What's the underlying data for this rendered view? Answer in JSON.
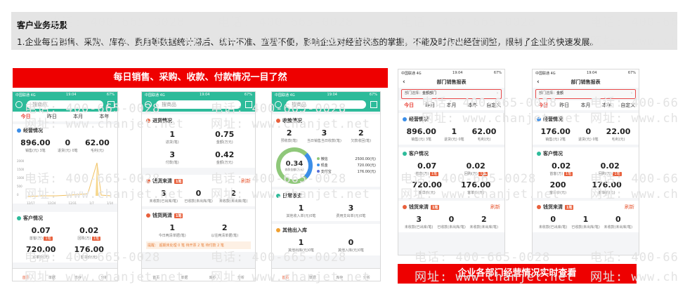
{
  "header": {
    "title": "客户业务场景",
    "desc": "1.企业每日销售、采购、库存、费用等数据统计滞后、统计不准、查看不便，影响企业对经营状态的掌握，不能及时作出经营调整，限制了企业的快速发展。"
  },
  "watermark": {
    "phone": "电话: 400-665-0028",
    "site": "网址: www.chanjet.net"
  },
  "banner1": "每日销售、采购、收款、付款情况一目了然",
  "banner2": "企业各部门经营情况实时查看",
  "common": {
    "search": "搜商品",
    "tabs": [
      "今日",
      "昨日",
      "本月",
      "本年"
    ],
    "bottom": [
      "首页",
      "单据",
      "库存",
      "分析"
    ],
    "refresh": "刷新",
    "time": "19:04",
    "carrier": "中国联通 4G",
    "batt": "67%"
  },
  "phone1": {
    "sec1": "经营情况",
    "kpis": [
      {
        "v": "896.00",
        "l": "销售(元) 3笔"
      },
      {
        "v": "0",
        "l": "退货(元) 0笔"
      },
      {
        "v": "62.00",
        "l": "毛利(元)"
      }
    ],
    "yaxis": [
      "2000",
      "1500",
      "1000",
      "500",
      "0"
    ],
    "xaxis": [
      "12/17",
      "12/24",
      "12/31",
      "1/7",
      "1/14"
    ],
    "sec2": "客户情况",
    "kpis2": [
      {
        "v": "0.07",
        "l": "首客(万)",
        "tag": "1笔"
      },
      {
        "v": "0.02",
        "l": "回购(万)",
        "tag": "1笔"
      }
    ],
    "kpis3": [
      {
        "v": "720.00",
        "l": "客单价(元)"
      },
      {
        "v": "176.00",
        "l": "客单价(元)"
      }
    ]
  },
  "phone2": {
    "sec1": "进货情况",
    "grid": [
      {
        "v": "1",
        "l": "进货(笔)"
      },
      {
        "v": "0.75",
        "l": "金额(万元)"
      },
      {
        "v": "3",
        "l": "付款(笔)"
      },
      {
        "v": "0.42",
        "l": "金额(万元)"
      }
    ],
    "sec2": "钱货来清",
    "tag2": "1笔",
    "row2": [
      {
        "v": "3",
        "l": "未收款(已出库/笔)"
      },
      {
        "v": "0",
        "l": "已收款(未出库/笔)"
      },
      {
        "v": "2",
        "l": "未收款(未出库/笔)"
      }
    ],
    "sec3": "钱货两清",
    "tag3": "1笔",
    "row3": [
      {
        "v": "1",
        "l": "今日两清单据(笔)"
      },
      {
        "v": "2",
        "l": "以往两清单据(笔)"
      }
    ],
    "footer": "提醒：  超期未处理 0 笔    待开票 2 笔    待付款 2 笔"
  },
  "phone3": {
    "sec1": "收款情况",
    "top": [
      {
        "v": "2",
        "l": "预收款(笔)"
      },
      {
        "v": "3",
        "l": "当日销售当日收款(笔)"
      },
      {
        "v": "2",
        "l": "欠款收回(笔)"
      }
    ],
    "donut_value": "0.34",
    "donut_label": "收款金额(万元)",
    "legend": [
      {
        "n": "微信",
        "v": "2500.00(元)"
      },
      {
        "n": "现金",
        "v": "720.00(元)"
      },
      {
        "n": "支付宝",
        "v": "176.00(元)"
      }
    ],
    "sec2": "日常收支",
    "row2": [
      {
        "v": "1",
        "l": "其他收入单(元)0笔"
      },
      {
        "v": "3",
        "l": "费用支出单(元)0笔"
      }
    ],
    "sec3": "其他出入库",
    "row3": [
      {
        "v": "1",
        "l": "其他出库(元)0笔"
      },
      {
        "v": "0",
        "l": "其他入库(元)0笔"
      }
    ]
  },
  "phone4": {
    "nav": "部门销售报表",
    "sel_label": "部门选择：",
    "sel_value": "金额部门",
    "sec1": "经营情况",
    "kpis": [
      {
        "v": "896.00",
        "l": "销售(元) 3笔"
      },
      {
        "v": "1",
        "l": "退货(元) 0笔"
      },
      {
        "v": "62.00",
        "l": "毛利(元)"
      }
    ],
    "sec2": "客户情况",
    "kpis2": [
      {
        "v": "0.07",
        "l": "首客(万)",
        "tag": "1笔"
      },
      {
        "v": "0.02",
        "l": "回购(万)",
        "tag": "1笔"
      }
    ],
    "kpis3": [
      {
        "v": "720.00",
        "l": "客单价(元)"
      },
      {
        "v": "176.00",
        "l": "客单价(元)"
      }
    ],
    "sec3": "钱货来清",
    "tag3": "1笔",
    "row3": [
      {
        "v": "3",
        "l": "未收款(已出库/笔)"
      },
      {
        "v": "0",
        "l": "已收款(未出库/笔)"
      },
      {
        "v": "2",
        "l": "未收款(未出库/笔)"
      }
    ],
    "tabs_extra": "自定义"
  },
  "phone5": {
    "nav": "部门销售报表",
    "sel_label": "部门选择：",
    "sel_value": "金额",
    "sec1": "经营情况",
    "kpis": [
      {
        "v": "176.00",
        "l": "销售(元) 2笔"
      },
      {
        "v": "0",
        "l": "退货(元) 0笔"
      },
      {
        "v": "22.00",
        "l": "毛利(元)"
      }
    ],
    "sec2": "客户情况",
    "kpis2": [
      {
        "v": "0.02",
        "l": "首客(万)",
        "tag": "1笔"
      },
      {
        "v": "0.02",
        "l": "回购(万)",
        "tag": "1笔"
      }
    ],
    "kpis3": [
      {
        "v": "200",
        "l": "客单价(元)"
      },
      {
        "v": "176.00",
        "l": "客单价(元)"
      }
    ],
    "sec3": "钱货来清",
    "tag3": "1笔",
    "row3": [
      {
        "v": "0",
        "l": "未收款(已出库/笔)"
      },
      {
        "v": "1",
        "l": "已收款(未出库/笔)"
      },
      {
        "v": "0",
        "l": "未收款(未出库/笔)"
      }
    ]
  }
}
